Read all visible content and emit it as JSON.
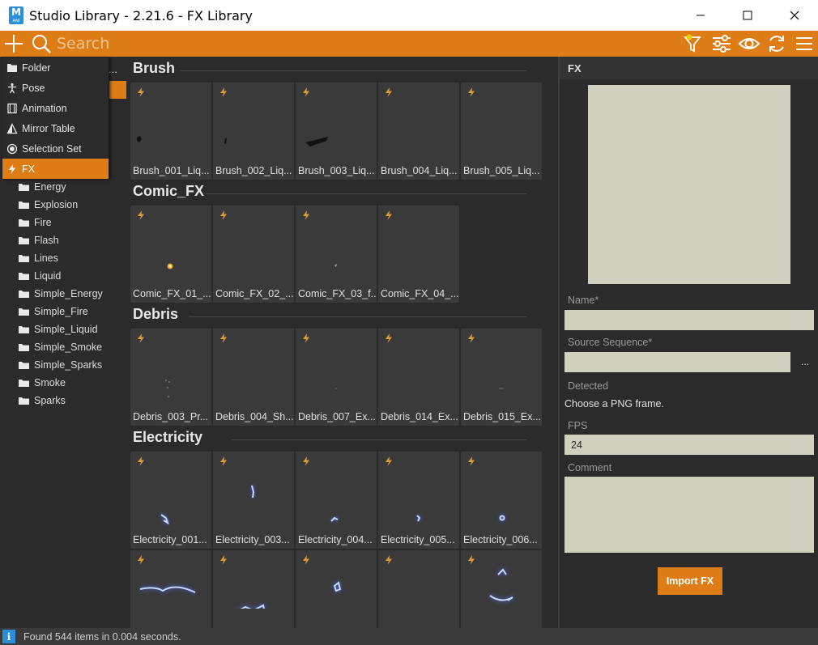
{
  "window": {
    "title": "Studio Library - 2.21.6 - FX Library",
    "app_icon_letter": "M",
    "app_icon_sub": "ANI"
  },
  "toolbar": {
    "search_placeholder": "Search"
  },
  "sidebar": {
    "header": "...",
    "items": [
      {
        "label": "Energy"
      },
      {
        "label": "Explosion"
      },
      {
        "label": "Fire"
      },
      {
        "label": "Flash"
      },
      {
        "label": "Lines"
      },
      {
        "label": "Liquid"
      },
      {
        "label": "Simple_Energy"
      },
      {
        "label": "Simple_Fire"
      },
      {
        "label": "Simple_Liquid"
      },
      {
        "label": "Simple_Smoke"
      },
      {
        "label": "Simple_Sparks"
      },
      {
        "label": "Smoke"
      },
      {
        "label": "Sparks"
      }
    ]
  },
  "menu": {
    "items": [
      {
        "label": "Folder",
        "icon": "folder-icon"
      },
      {
        "label": "Pose",
        "icon": "pose-icon"
      },
      {
        "label": "Animation",
        "icon": "film-icon"
      },
      {
        "label": "Mirror Table",
        "icon": "mirror-icon"
      },
      {
        "label": "Selection Set",
        "icon": "selection-icon"
      },
      {
        "label": "FX",
        "icon": "bolt-icon",
        "active": true
      }
    ]
  },
  "library": {
    "sections": [
      {
        "title": "Brush",
        "items": [
          "Brush_001_Liq...",
          "Brush_002_Liq...",
          "Brush_003_Liq...",
          "Brush_004_Liq...",
          "Brush_005_Liq..."
        ]
      },
      {
        "title": "Comic_FX",
        "items": [
          "Comic_FX_01_...",
          "Comic_FX_02_...",
          "Comic_FX_03_f...",
          "Comic_FX_04_..."
        ]
      },
      {
        "title": "Debris",
        "items": [
          "Debris_003_Pr...",
          "Debris_004_Sh...",
          "Debris_007_Ex...",
          "Debris_014_Ex...",
          "Debris_015_Ex..."
        ]
      },
      {
        "title": "Electricity",
        "items": [
          "Electricity_001...",
          "Electricity_003...",
          "Electricity_004...",
          "Electricity_005...",
          "Electricity_006..."
        ]
      }
    ]
  },
  "panel": {
    "title": "FX",
    "name_label": "Name*",
    "name_value": "",
    "source_label": "Source Sequence*",
    "source_value": "",
    "browse_label": "...",
    "detected_label": "Detected",
    "detected_text": "Choose a PNG frame.",
    "fps_label": "FPS",
    "fps_value": "24",
    "comment_label": "Comment",
    "comment_value": "",
    "import_label": "Import FX"
  },
  "status": {
    "text": "Found 544 items in 0.004 seconds.",
    "info_icon": "i"
  },
  "colors": {
    "accent": "#de7d16",
    "background": "#2b2b2b",
    "field": "#d0d0bf",
    "info": "#2b8ed6"
  }
}
